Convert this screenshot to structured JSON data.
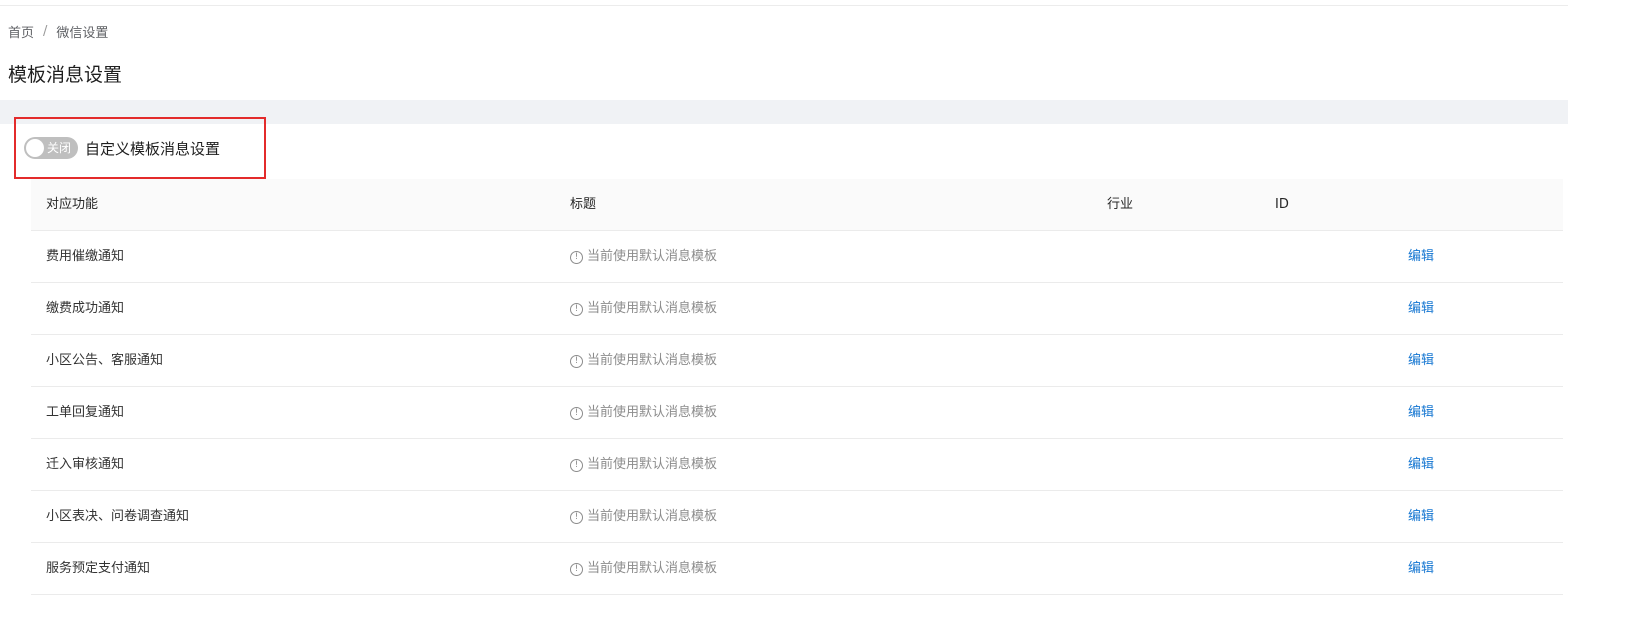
{
  "breadcrumb": {
    "home": "首页",
    "separator": "/",
    "current": "微信设置"
  },
  "page": {
    "title": "模板消息设置"
  },
  "switch": {
    "state_text": "关闭",
    "label": "自定义模板消息设置",
    "on": false
  },
  "table": {
    "columns": {
      "function": "对应功能",
      "title": "标题",
      "industry": "行业",
      "id": "ID"
    },
    "rows": [
      {
        "function": "费用催缴通知",
        "title": "当前使用默认消息模板",
        "action": "编辑"
      },
      {
        "function": "缴费成功通知",
        "title": "当前使用默认消息模板",
        "action": "编辑"
      },
      {
        "function": "小区公告、客服通知",
        "title": "当前使用默认消息模板",
        "action": "编辑"
      },
      {
        "function": "工单回复通知",
        "title": "当前使用默认消息模板",
        "action": "编辑"
      },
      {
        "function": "迁入审核通知",
        "title": "当前使用默认消息模板",
        "action": "编辑"
      },
      {
        "function": "小区表决、问卷调查通知",
        "title": "当前使用默认消息模板",
        "action": "编辑"
      },
      {
        "function": "服务预定支付通知",
        "title": "当前使用默认消息模板",
        "action": "编辑"
      }
    ]
  },
  "colors": {
    "accent": "#1677d2",
    "highlight_border": "#e32b2b",
    "switch_off": "#bfbfbf"
  },
  "icons": {
    "row_info": "info-circle-icon"
  }
}
